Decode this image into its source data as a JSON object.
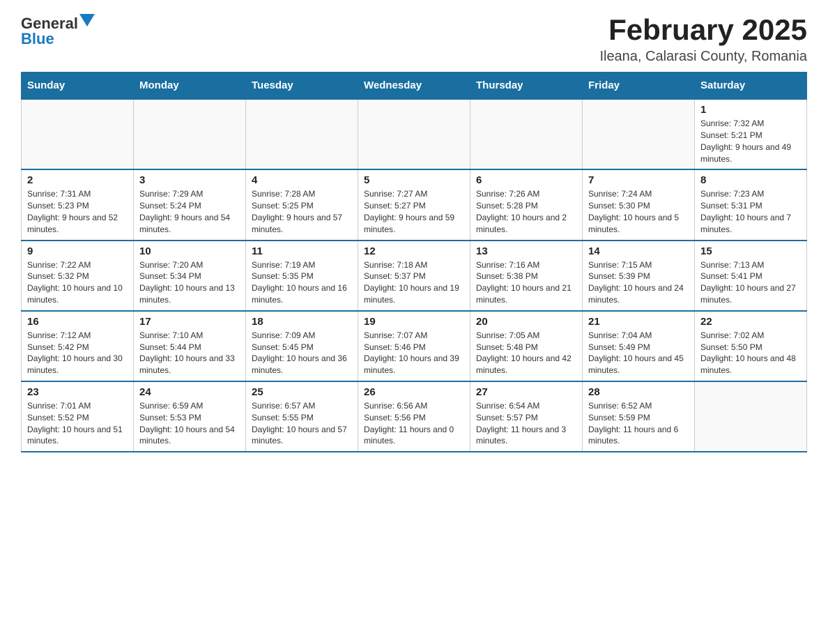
{
  "header": {
    "logo_general": "General",
    "logo_blue": "Blue",
    "title": "February 2025",
    "location": "Ileana, Calarasi County, Romania"
  },
  "days_of_week": [
    "Sunday",
    "Monday",
    "Tuesday",
    "Wednesday",
    "Thursday",
    "Friday",
    "Saturday"
  ],
  "weeks": [
    [
      {
        "day": "",
        "info": ""
      },
      {
        "day": "",
        "info": ""
      },
      {
        "day": "",
        "info": ""
      },
      {
        "day": "",
        "info": ""
      },
      {
        "day": "",
        "info": ""
      },
      {
        "day": "",
        "info": ""
      },
      {
        "day": "1",
        "info": "Sunrise: 7:32 AM\nSunset: 5:21 PM\nDaylight: 9 hours and 49 minutes."
      }
    ],
    [
      {
        "day": "2",
        "info": "Sunrise: 7:31 AM\nSunset: 5:23 PM\nDaylight: 9 hours and 52 minutes."
      },
      {
        "day": "3",
        "info": "Sunrise: 7:29 AM\nSunset: 5:24 PM\nDaylight: 9 hours and 54 minutes."
      },
      {
        "day": "4",
        "info": "Sunrise: 7:28 AM\nSunset: 5:25 PM\nDaylight: 9 hours and 57 minutes."
      },
      {
        "day": "5",
        "info": "Sunrise: 7:27 AM\nSunset: 5:27 PM\nDaylight: 9 hours and 59 minutes."
      },
      {
        "day": "6",
        "info": "Sunrise: 7:26 AM\nSunset: 5:28 PM\nDaylight: 10 hours and 2 minutes."
      },
      {
        "day": "7",
        "info": "Sunrise: 7:24 AM\nSunset: 5:30 PM\nDaylight: 10 hours and 5 minutes."
      },
      {
        "day": "8",
        "info": "Sunrise: 7:23 AM\nSunset: 5:31 PM\nDaylight: 10 hours and 7 minutes."
      }
    ],
    [
      {
        "day": "9",
        "info": "Sunrise: 7:22 AM\nSunset: 5:32 PM\nDaylight: 10 hours and 10 minutes."
      },
      {
        "day": "10",
        "info": "Sunrise: 7:20 AM\nSunset: 5:34 PM\nDaylight: 10 hours and 13 minutes."
      },
      {
        "day": "11",
        "info": "Sunrise: 7:19 AM\nSunset: 5:35 PM\nDaylight: 10 hours and 16 minutes."
      },
      {
        "day": "12",
        "info": "Sunrise: 7:18 AM\nSunset: 5:37 PM\nDaylight: 10 hours and 19 minutes."
      },
      {
        "day": "13",
        "info": "Sunrise: 7:16 AM\nSunset: 5:38 PM\nDaylight: 10 hours and 21 minutes."
      },
      {
        "day": "14",
        "info": "Sunrise: 7:15 AM\nSunset: 5:39 PM\nDaylight: 10 hours and 24 minutes."
      },
      {
        "day": "15",
        "info": "Sunrise: 7:13 AM\nSunset: 5:41 PM\nDaylight: 10 hours and 27 minutes."
      }
    ],
    [
      {
        "day": "16",
        "info": "Sunrise: 7:12 AM\nSunset: 5:42 PM\nDaylight: 10 hours and 30 minutes."
      },
      {
        "day": "17",
        "info": "Sunrise: 7:10 AM\nSunset: 5:44 PM\nDaylight: 10 hours and 33 minutes."
      },
      {
        "day": "18",
        "info": "Sunrise: 7:09 AM\nSunset: 5:45 PM\nDaylight: 10 hours and 36 minutes."
      },
      {
        "day": "19",
        "info": "Sunrise: 7:07 AM\nSunset: 5:46 PM\nDaylight: 10 hours and 39 minutes."
      },
      {
        "day": "20",
        "info": "Sunrise: 7:05 AM\nSunset: 5:48 PM\nDaylight: 10 hours and 42 minutes."
      },
      {
        "day": "21",
        "info": "Sunrise: 7:04 AM\nSunset: 5:49 PM\nDaylight: 10 hours and 45 minutes."
      },
      {
        "day": "22",
        "info": "Sunrise: 7:02 AM\nSunset: 5:50 PM\nDaylight: 10 hours and 48 minutes."
      }
    ],
    [
      {
        "day": "23",
        "info": "Sunrise: 7:01 AM\nSunset: 5:52 PM\nDaylight: 10 hours and 51 minutes."
      },
      {
        "day": "24",
        "info": "Sunrise: 6:59 AM\nSunset: 5:53 PM\nDaylight: 10 hours and 54 minutes."
      },
      {
        "day": "25",
        "info": "Sunrise: 6:57 AM\nSunset: 5:55 PM\nDaylight: 10 hours and 57 minutes."
      },
      {
        "day": "26",
        "info": "Sunrise: 6:56 AM\nSunset: 5:56 PM\nDaylight: 11 hours and 0 minutes."
      },
      {
        "day": "27",
        "info": "Sunrise: 6:54 AM\nSunset: 5:57 PM\nDaylight: 11 hours and 3 minutes."
      },
      {
        "day": "28",
        "info": "Sunrise: 6:52 AM\nSunset: 5:59 PM\nDaylight: 11 hours and 6 minutes."
      },
      {
        "day": "",
        "info": ""
      }
    ]
  ]
}
